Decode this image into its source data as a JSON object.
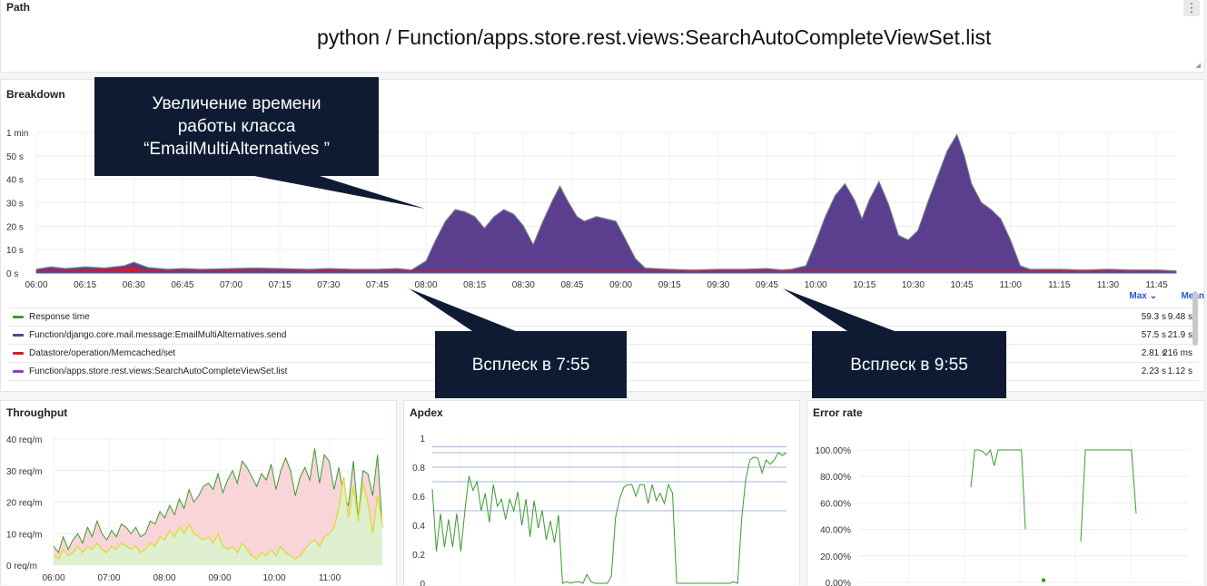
{
  "path_panel": {
    "title": "Path",
    "value": "python / Function/apps.store.rest.views:SearchAutoCompleteViewSet.list",
    "menu_glyph": "⋮"
  },
  "breakdown": {
    "title": "Breakdown",
    "legend_header": {
      "max": "Max ⌄",
      "mean": "Mean"
    },
    "legend": [
      {
        "name": "Response time",
        "color": "#3a9a2e",
        "max": "59.3 s",
        "mean": "9.48 s"
      },
      {
        "name": "Function/django.core.mail.message:EmailMultiAlternatives.send",
        "color": "#5b3f8e",
        "max": "57.5 s",
        "mean": "21.9 s"
      },
      {
        "name": "Datastore/operation/Memcached/set",
        "color": "#d9182a",
        "max": "2.81 s",
        "mean": "216 ms"
      },
      {
        "name": "Function/apps.store.rest.views:SearchAutoCompleteViewSet.list",
        "color": "#8a3fcf",
        "max": "2.23 s",
        "mean": "1.12 s"
      }
    ]
  },
  "callouts": {
    "top": [
      "Увеличение времени",
      "работы класса",
      "“EmailMultiAlternatives ”"
    ],
    "mid": "Всплеск в 7:55",
    "right": "Всплеск в 9:55"
  },
  "throughput": {
    "title": "Throughput"
  },
  "apdex": {
    "title": "Apdex"
  },
  "error_rate": {
    "title": "Error rate"
  },
  "chart_data": [
    {
      "type": "area",
      "name": "breakdown",
      "x": [
        "06:00",
        "06:15",
        "06:30",
        "06:45",
        "07:00",
        "07:15",
        "07:30",
        "07:45",
        "08:00",
        "08:15",
        "08:30",
        "08:45",
        "09:00",
        "09:15",
        "09:30",
        "09:45",
        "10:00",
        "10:15",
        "10:30",
        "10:45",
        "11:00",
        "11:15",
        "11:30",
        "11:45"
      ],
      "y_ticks": [
        "0 s",
        "10 s",
        "20 s",
        "30 s",
        "40 s",
        "50 s",
        "1 min"
      ],
      "ylim": [
        0,
        60
      ],
      "series": [
        {
          "name": "Function/django.core.mail.message:EmailMultiAlternatives.send",
          "color": "#5b3f8e",
          "points": [
            [
              0,
              1.5
            ],
            [
              0.3,
              2.5
            ],
            [
              0.6,
              1.8
            ],
            [
              1,
              2.5
            ],
            [
              1.4,
              2.0
            ],
            [
              1.8,
              3.0
            ],
            [
              2,
              4.5
            ],
            [
              2.3,
              2.2
            ],
            [
              2.7,
              1.5
            ],
            [
              3,
              1.8
            ],
            [
              3.4,
              1.5
            ],
            [
              4,
              1.8
            ],
            [
              4.5,
              2.0
            ],
            [
              5,
              1.8
            ],
            [
              5.6,
              1.5
            ],
            [
              6,
              1.8
            ],
            [
              6.5,
              1.5
            ],
            [
              7,
              1.5
            ],
            [
              7.4,
              1.8
            ],
            [
              7.7,
              1.2
            ],
            [
              8,
              5
            ],
            [
              8.2,
              14
            ],
            [
              8.4,
              22
            ],
            [
              8.6,
              27
            ],
            [
              8.8,
              26
            ],
            [
              9,
              24
            ],
            [
              9.2,
              19
            ],
            [
              9.4,
              24
            ],
            [
              9.6,
              27
            ],
            [
              9.8,
              25
            ],
            [
              10,
              20
            ],
            [
              10.2,
              12
            ],
            [
              10.4,
              22
            ],
            [
              10.6,
              31
            ],
            [
              10.75,
              37
            ],
            [
              10.9,
              31
            ],
            [
              11.1,
              24
            ],
            [
              11.25,
              22
            ],
            [
              11.5,
              24
            ],
            [
              11.7,
              23
            ],
            [
              11.9,
              22
            ],
            [
              12.1,
              14
            ],
            [
              12.3,
              6
            ],
            [
              12.5,
              2
            ],
            [
              13,
              1.5
            ],
            [
              13.5,
              1.2
            ],
            [
              14,
              1.5
            ],
            [
              14.5,
              1.5
            ],
            [
              15,
              1.8
            ],
            [
              15.3,
              1.2
            ],
            [
              15.5,
              1.5
            ],
            [
              15.8,
              3
            ],
            [
              16,
              13
            ],
            [
              16.2,
              24
            ],
            [
              16.4,
              33
            ],
            [
              16.6,
              38
            ],
            [
              16.8,
              31
            ],
            [
              16.95,
              23
            ],
            [
              17.1,
              31
            ],
            [
              17.3,
              39
            ],
            [
              17.5,
              29
            ],
            [
              17.7,
              16
            ],
            [
              17.9,
              14
            ],
            [
              18.1,
              18
            ],
            [
              18.3,
              30
            ],
            [
              18.5,
              41
            ],
            [
              18.7,
              52
            ],
            [
              18.9,
              59
            ],
            [
              19.05,
              50
            ],
            [
              19.2,
              38
            ],
            [
              19.4,
              30
            ],
            [
              19.6,
              27
            ],
            [
              19.8,
              23
            ],
            [
              20,
              14
            ],
            [
              20.2,
              3
            ],
            [
              20.4,
              1.5
            ],
            [
              21,
              1.5
            ],
            [
              21.5,
              1.2
            ],
            [
              22,
              1.5
            ],
            [
              22.5,
              1.2
            ],
            [
              23,
              1.2
            ],
            [
              23.4,
              0.8
            ]
          ]
        },
        {
          "name": "Datastore/operation/Memcached/set",
          "color": "#d9182a",
          "points": [
            [
              0,
              0.8
            ],
            [
              1,
              1.2
            ],
            [
              1.8,
              2.0
            ],
            [
              2,
              2.8
            ],
            [
              2.2,
              1.2
            ],
            [
              3,
              0.8
            ],
            [
              4,
              1.0
            ],
            [
              5,
              0.8
            ],
            [
              6,
              1.0
            ],
            [
              7,
              0.8
            ],
            [
              8,
              0.9
            ],
            [
              9,
              0.8
            ],
            [
              10,
              0.9
            ],
            [
              11,
              0.8
            ],
            [
              12,
              0.9
            ],
            [
              13,
              0.8
            ],
            [
              14,
              0.9
            ],
            [
              15,
              0.8
            ],
            [
              16,
              0.8
            ],
            [
              17,
              0.9
            ],
            [
              18,
              0.8
            ],
            [
              19,
              0.8
            ],
            [
              20,
              0.9
            ],
            [
              21,
              1.0
            ],
            [
              22,
              0.8
            ],
            [
              23.4,
              0.6
            ]
          ]
        },
        {
          "name": "Response time",
          "color": "#3a9a2e",
          "points": [
            [
              0,
              1.8
            ],
            [
              2,
              4.6
            ],
            [
              7.7,
              1.3
            ],
            [
              8.6,
              27.2
            ],
            [
              10.75,
              37.2
            ],
            [
              16.6,
              38.2
            ],
            [
              18.9,
              59.3
            ],
            [
              20.4,
              1.6
            ],
            [
              23.4,
              0.9
            ]
          ]
        }
      ]
    },
    {
      "type": "area",
      "name": "throughput",
      "x": [
        "06:00",
        "07:00",
        "08:00",
        "09:00",
        "10:00",
        "11:00"
      ],
      "y_ticks": [
        "0 req/m",
        "10 req/m",
        "20 req/m",
        "30 req/m",
        "40 req/m"
      ],
      "ylim": [
        0,
        40
      ],
      "series": [
        {
          "name": "total",
          "color": "#3a9a2e",
          "fill": "#f9d5da",
          "values": [
            6,
            4,
            9,
            5,
            8,
            10,
            7,
            12,
            9,
            14,
            10,
            8,
            11,
            9,
            13,
            12,
            10,
            12,
            9,
            10,
            14,
            13,
            17,
            15,
            19,
            16,
            21,
            18,
            24,
            20,
            22,
            25,
            26,
            24,
            29,
            23,
            27,
            30,
            26,
            33,
            31,
            28,
            25,
            29,
            27,
            32,
            24,
            30,
            34,
            30,
            22,
            28,
            31,
            27,
            37,
            26,
            35,
            33,
            24,
            31,
            22,
            19,
            33,
            15,
            30,
            29,
            22,
            35,
            12
          ]
        },
        {
          "name": "secondary",
          "color": "#e0dc4c",
          "fill": "#dff0d0",
          "values": [
            3,
            2,
            5,
            3,
            4,
            6,
            4,
            6,
            5,
            7,
            5,
            4,
            6,
            5,
            7,
            6,
            5,
            6,
            4,
            5,
            7,
            6,
            9,
            8,
            11,
            9,
            12,
            10,
            13,
            10,
            9,
            8,
            9,
            7,
            10,
            6,
            5,
            6,
            4,
            7,
            5,
            3,
            2,
            4,
            3,
            5,
            3,
            6,
            4,
            3,
            2,
            3,
            5,
            7,
            8,
            6,
            9,
            10,
            12,
            18,
            28,
            15,
            25,
            14,
            26,
            20,
            10,
            22,
            13
          ]
        }
      ]
    },
    {
      "type": "line",
      "name": "apdex",
      "y_ticks": [
        "0",
        "0.2",
        "0.4",
        "0.6",
        "0.8",
        "1"
      ],
      "ylim": [
        0,
        1
      ],
      "threshold_lines": [
        0.5,
        0.7,
        0.8,
        0.9,
        0.94
      ],
      "series": [
        {
          "name": "apdex",
          "color": "#3a9a2e",
          "values": [
            0.65,
            0.22,
            0.48,
            0.25,
            0.44,
            0.25,
            0.48,
            0.22,
            0.5,
            0.74,
            0.64,
            0.7,
            0.5,
            0.62,
            0.42,
            0.68,
            0.53,
            0.58,
            0.44,
            0.58,
            0.5,
            0.63,
            0.4,
            0.58,
            0.32,
            0.57,
            0.38,
            0.5,
            0.3,
            0.43,
            0.28,
            0.47,
            0.0,
            0.01,
            0.0,
            0.01,
            0.01,
            0.0,
            0.06,
            0.01,
            0.0,
            0.0,
            0.0,
            0.0,
            0.05,
            0.45,
            0.58,
            0.66,
            0.68,
            0.68,
            0.6,
            0.68,
            0.68,
            0.55,
            0.68,
            0.57,
            0.62,
            0.55,
            0.68,
            0.62,
            0.0,
            0.0,
            0.0,
            0.0,
            0.0,
            0.0,
            0.0,
            0.0,
            0.0,
            0.0,
            0.0,
            0.0,
            0.0,
            0.0,
            0.01,
            0.0,
            0.45,
            0.72,
            0.85,
            0.87,
            0.86,
            0.76,
            0.85,
            0.82,
            0.85,
            0.9,
            0.88,
            0.9
          ]
        }
      ]
    },
    {
      "type": "line",
      "name": "error_rate",
      "y_ticks": [
        "0.00%",
        "20.00%",
        "40.00%",
        "60.00%",
        "80.00%",
        "100.00%"
      ],
      "ylim": [
        0,
        100
      ],
      "series": [
        {
          "name": "segment1",
          "color": "#3a9a2e",
          "values": [
            72,
            100,
            100,
            99,
            96,
            100,
            88,
            100,
            100,
            100,
            100,
            100,
            100,
            100,
            40
          ]
        },
        {
          "name": "segment2",
          "color": "#3a9a2e",
          "values": [
            31,
            100,
            100,
            100,
            100,
            100,
            100,
            100,
            100,
            100,
            100,
            100,
            52
          ]
        },
        {
          "name": "dot",
          "color": "#3a9a2e",
          "values": [
            1
          ]
        }
      ]
    }
  ]
}
